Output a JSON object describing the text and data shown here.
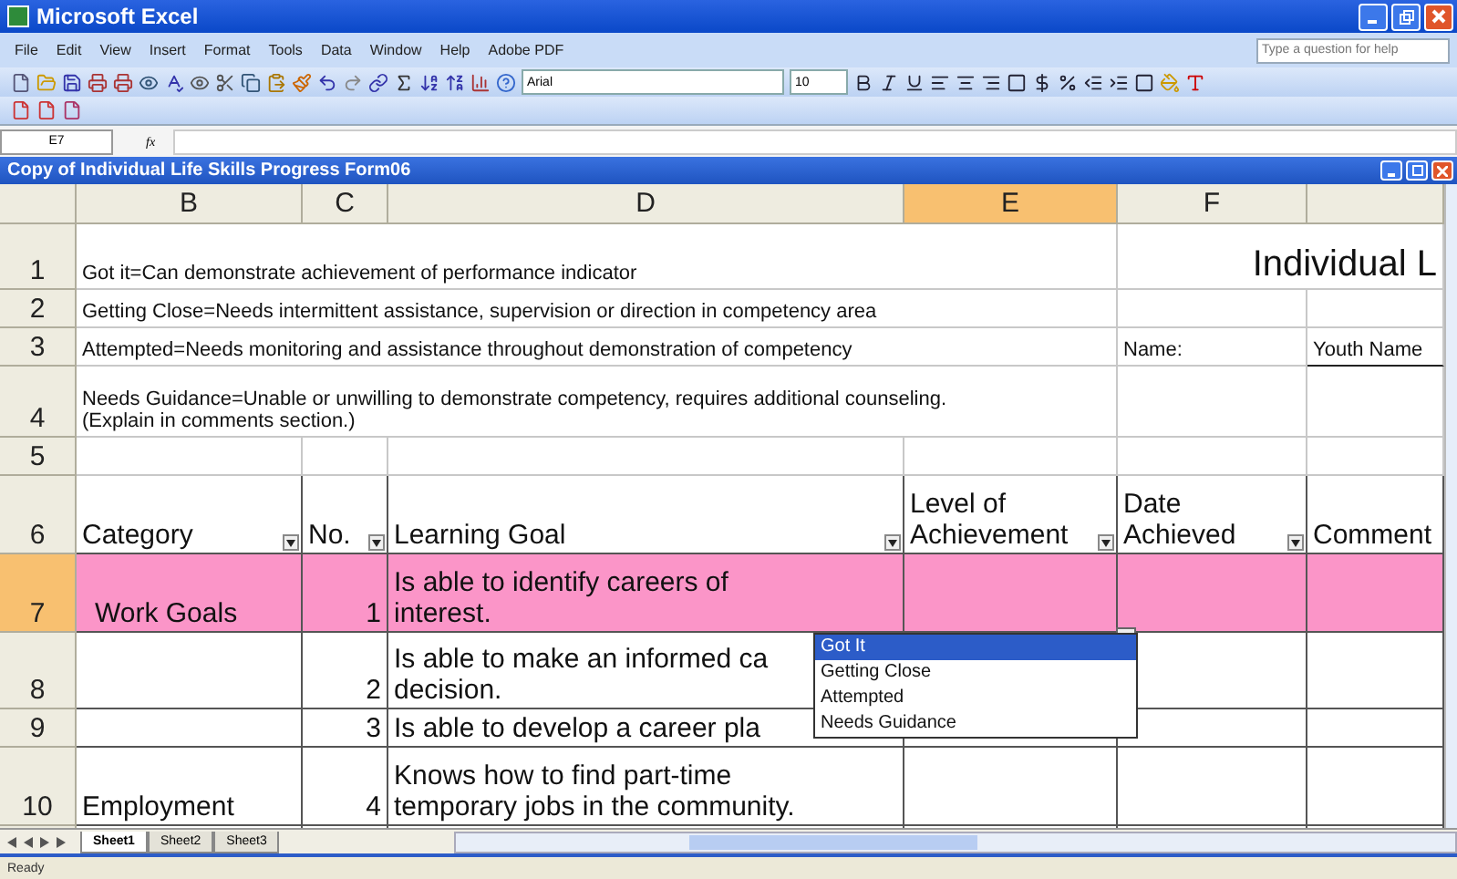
{
  "window": {
    "title": "Microsoft Excel"
  },
  "menu": [
    {
      "label": "File"
    },
    {
      "label": "Edit"
    },
    {
      "label": "View"
    },
    {
      "label": "Insert"
    },
    {
      "label": "Format"
    },
    {
      "label": "Tools"
    },
    {
      "label": "Data"
    },
    {
      "label": "Window"
    },
    {
      "label": "Help"
    },
    {
      "label": "Adobe PDF"
    }
  ],
  "help_box": {
    "placeholder": "Type a question for help"
  },
  "formatting": {
    "font": "Arial",
    "size": "10"
  },
  "formula_bar": {
    "name_box": "E7",
    "fx": "fx"
  },
  "workbook": {
    "title": "Copy of Individual Life Skills Progress Form06"
  },
  "columns": [
    {
      "label": "B",
      "selected": false
    },
    {
      "label": "C",
      "selected": false
    },
    {
      "label": "D",
      "selected": false
    },
    {
      "label": "E",
      "selected": true
    },
    {
      "label": "F",
      "selected": false
    }
  ],
  "rows": [
    {
      "number": "1",
      "selected": false
    },
    {
      "number": "2",
      "selected": false
    },
    {
      "number": "3",
      "selected": false
    },
    {
      "number": "4",
      "selected": false
    },
    {
      "number": "5",
      "selected": false
    },
    {
      "number": "6",
      "selected": false
    },
    {
      "number": "7",
      "selected": true
    },
    {
      "number": "8",
      "selected": false
    },
    {
      "number": "9",
      "selected": false
    },
    {
      "number": "10",
      "selected": false
    }
  ],
  "notes": [
    [
      "Got it=Can demonstrate achievement of performance indicator"
    ],
    [
      "Getting Close=Needs intermittent assistance, supervision or direction in competency area"
    ],
    [
      "Attempted=Needs monitoring and assistance throughout demonstration of competency"
    ],
    [
      "Needs Guidance=Unable or unwilling to demonstrate competency, requires additional counseling.",
      "(Explain in comments section.)"
    ]
  ],
  "form_title": "Individual L",
  "name_label": "Name:",
  "name_value": "Youth Name",
  "header": {
    "category": "Category",
    "no": "No.",
    "goal": "Learning Goal",
    "level": [
      "Level of",
      "Achievement"
    ],
    "date": [
      "Date",
      "Achieved"
    ],
    "comment": "Comment"
  },
  "goals": [
    {
      "category": "Work Goals",
      "no": "1",
      "goal": [
        "Is able to identify careers of",
        "interest."
      ],
      "highlighted": true
    },
    {
      "no": "2",
      "goal": [
        "Is able to make an informed ca",
        "decision."
      ],
      "highlighted": false
    },
    {
      "no": "3",
      "goal": [
        "Is able to develop a career pla"
      ],
      "highlighted": false
    },
    {
      "category": "Employment",
      "no": "4",
      "goal": [
        "Knows how to find part-time",
        "temporary jobs in the community."
      ],
      "highlighted": false
    }
  ],
  "dropdown": {
    "items": [
      {
        "label": "Got It",
        "selected": true
      },
      {
        "label": "Getting Close",
        "selected": false
      },
      {
        "label": "Attempted",
        "selected": false
      },
      {
        "label": "Needs Guidance",
        "selected": false
      }
    ]
  },
  "sheet_tabs": [
    {
      "label": "Sheet1",
      "selected": true
    },
    {
      "label": "Sheet2",
      "selected": false
    },
    {
      "label": "Sheet3",
      "selected": false
    }
  ],
  "status_bar": {
    "text": "Ready"
  }
}
